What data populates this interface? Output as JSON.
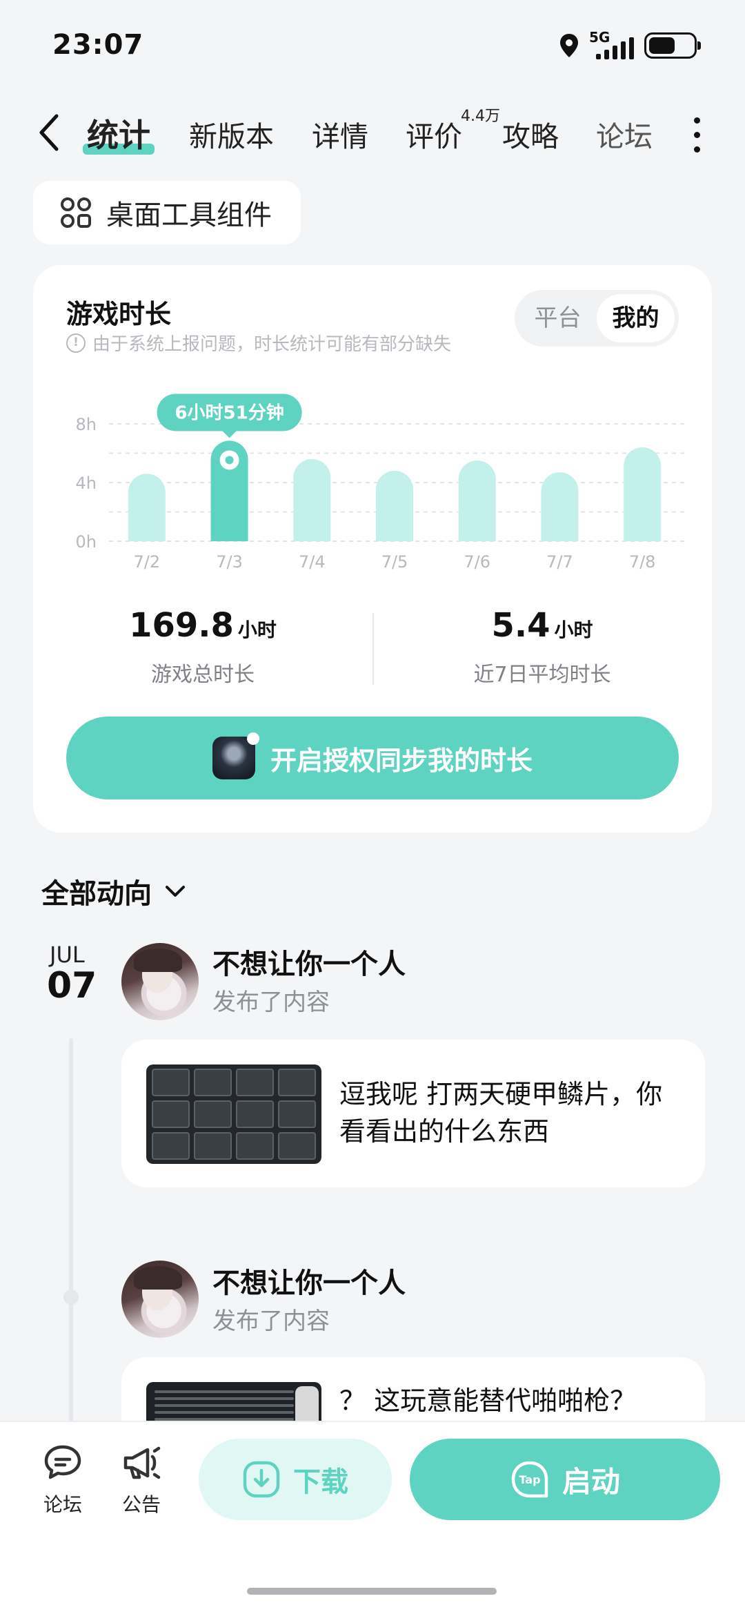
{
  "status_bar": {
    "time": "23:07",
    "network": "5G"
  },
  "tabs": [
    {
      "label": "统计",
      "active": true
    },
    {
      "label": "新版本"
    },
    {
      "label": "详情"
    },
    {
      "label": "评价",
      "badge": "4.4万"
    },
    {
      "label": "攻略"
    },
    {
      "label": "论坛"
    }
  ],
  "widget_pill": {
    "label": "桌面工具组件"
  },
  "playtime": {
    "title": "游戏时长",
    "notice": "由于系统上报问题，时长统计可能有部分缺失",
    "segment": {
      "options": [
        "平台",
        "我的"
      ],
      "selected": "我的"
    },
    "tooltip": "6小时51分钟",
    "total_value": "169.8",
    "total_unit": "小时",
    "total_caption": "游戏总时长",
    "avg_value": "5.4",
    "avg_unit": "小时",
    "avg_caption": "近7日平均时长",
    "sync_button": "开启授权同步我的时长"
  },
  "chart_data": {
    "type": "bar",
    "categories": [
      "7/2",
      "7/3",
      "7/4",
      "7/5",
      "7/6",
      "7/7",
      "7/8"
    ],
    "values": [
      4.6,
      6.85,
      5.6,
      4.8,
      5.5,
      4.7,
      6.4
    ],
    "yticks": [
      "8h",
      "4h",
      "0h"
    ],
    "ylim": [
      0,
      8
    ],
    "highlight_index": 1,
    "grid": true,
    "colors": {
      "bar": "#C3F0EA",
      "highlight": "#5FD3C2"
    }
  },
  "feed": {
    "title": "全部动向",
    "date_month": "JUL",
    "date_day": "07",
    "posts": [
      {
        "author": "不想让你一个人",
        "action": "发布了内容",
        "text": "逗我呢 打两天硬甲鳞片，你看看出的什么东西"
      },
      {
        "author": "不想让你一个人",
        "action": "发布了内容",
        "text": "？ 这玩意能替代啪啪枪？"
      }
    ]
  },
  "bottom_bar": {
    "forum_label": "论坛",
    "notice_label": "公告",
    "download_label": "下载",
    "start_label": "启动"
  },
  "colors": {
    "accent": "#5FD3C2",
    "accent_light": "#C3F0EA",
    "background": "#F4F5F7"
  }
}
